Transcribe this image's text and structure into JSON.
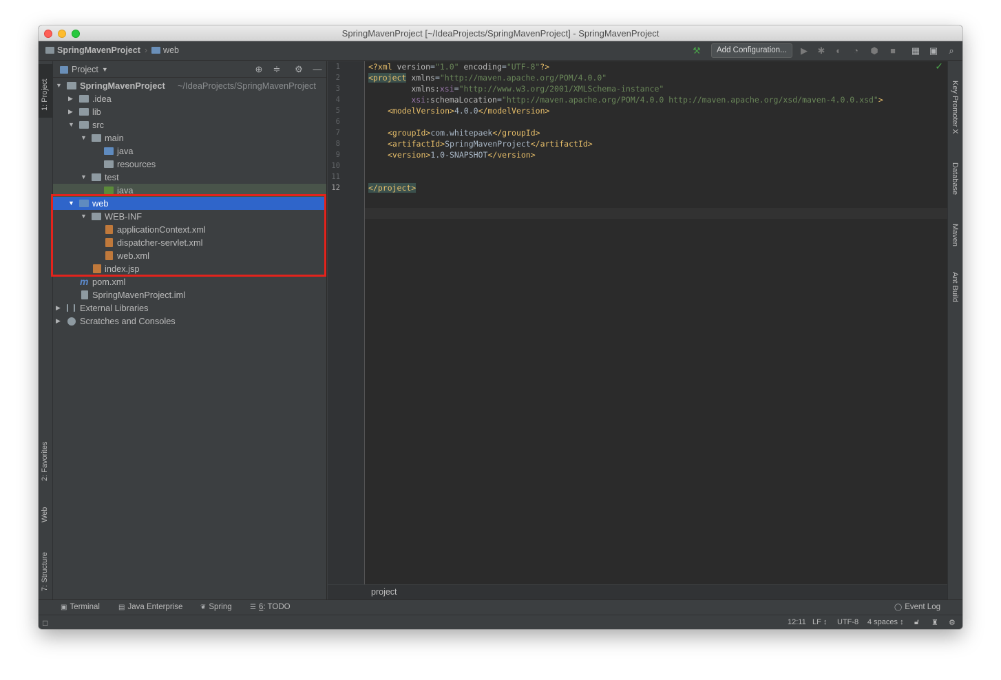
{
  "window": {
    "title": "SpringMavenProject [~/IdeaProjects/SpringMavenProject] - SpringMavenProject"
  },
  "navbar": {
    "project": "SpringMavenProject",
    "folder": "web",
    "add_config_label": "Add Configuration..."
  },
  "left_tools": {
    "project_tab": "1: Project",
    "favorites_tab": "2: Favorites",
    "web_tab": "Web",
    "structure_tab": "7: Structure"
  },
  "project_panel": {
    "title": "Project",
    "tree": [
      {
        "label": "SpringMavenProject",
        "path": "~/IdeaProjects/SpringMavenProject"
      },
      {
        "label": ".idea"
      },
      {
        "label": "lib"
      },
      {
        "label": "src"
      },
      {
        "label": "main"
      },
      {
        "label": "java"
      },
      {
        "label": "resources"
      },
      {
        "label": "test"
      },
      {
        "label": "java"
      },
      {
        "label": "web"
      },
      {
        "label": "WEB-INF"
      },
      {
        "label": "applicationContext.xml"
      },
      {
        "label": "dispatcher-servlet.xml"
      },
      {
        "label": "web.xml"
      },
      {
        "label": "index.jsp"
      },
      {
        "label": "pom.xml",
        "icon_text": "m"
      },
      {
        "label": "SpringMavenProject.iml"
      },
      {
        "label": "External Libraries"
      },
      {
        "label": "Scratches and Consoles"
      }
    ]
  },
  "editor": {
    "line_numbers": [
      "1",
      "2",
      "3",
      "4",
      "5",
      "6",
      "7",
      "8",
      "9",
      "10",
      "11",
      "12"
    ],
    "breadcrumb": "project",
    "code": {
      "l1_pi_open": "<?xml ",
      "l1_a1": "version",
      "l1_eq": "=",
      "l1_v1": "\"1.0\"",
      "l1_a2": " encoding",
      "l1_v2": "\"UTF-8\"",
      "l1_pi_close": "?>",
      "l2_tag": "<project",
      "l2_attr": " xmlns",
      "l2_val": "\"http://maven.apache.org/POM/4.0.0\"",
      "l3_indent": "         ",
      "l3_attr": "xmlns:",
      "l3_ns": "xsi",
      "l3_val": "\"http://www.w3.org/2001/XMLSchema-instance\"",
      "l4_ns": "xsi",
      "l4_attr": ":schemaLocation",
      "l4_val": "\"http://maven.apache.org/POM/4.0.0 http://maven.apache.org/xsd/maven-4.0.0.xsd\"",
      "l4_close": ">",
      "l5_open": "<modelVersion>",
      "l5_text": "4.0.0",
      "l5_close": "</modelVersion>",
      "l7_open": "<groupId>",
      "l7_text": "com.whitepaek",
      "l7_close": "</groupId>",
      "l8_open": "<artifactId>",
      "l8_text": "SpringMavenProject",
      "l8_close": "</artifactId>",
      "l9_open": "<version>",
      "l9_text": "1.0-SNAPSHOT",
      "l9_close": "</version>",
      "l12_tag": "</project>"
    }
  },
  "right_tools": {
    "key_promoter": "Key Promoter X",
    "database": "Database",
    "maven": "Maven",
    "ant": "Ant Build"
  },
  "bottom_tools": {
    "terminal": "Terminal",
    "java_enterprise": "Java Enterprise",
    "spring": "Spring",
    "todo_num": "6",
    "todo": ": TODO",
    "event_log": "Event Log"
  },
  "status": {
    "position": "12:11",
    "line_sep": "LF ↕",
    "encoding": "UTF-8",
    "indent": "4 spaces ↕"
  },
  "colors": {
    "selection": "#2f65ca",
    "highlight_box": "#e3231c",
    "tag": "#e8bf6a",
    "string": "#6a8759"
  }
}
